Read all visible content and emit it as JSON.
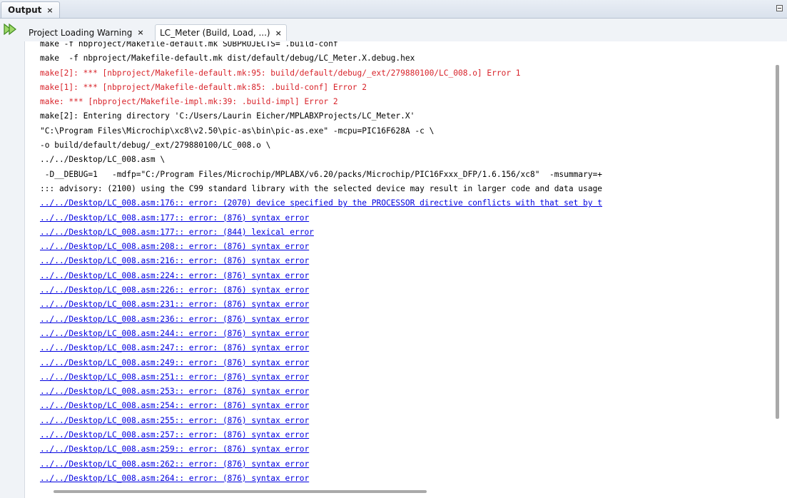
{
  "window": {
    "title": "Output",
    "close_glyph": "×"
  },
  "tabs": [
    {
      "label": "Project Loading Warning",
      "close_glyph": "×",
      "active": false
    },
    {
      "label": "LC_Meter (Build, Load, ...)",
      "close_glyph": "×",
      "active": true
    }
  ],
  "icons": {
    "rerun": "rerun-icon",
    "minimize": "minimize-icon"
  },
  "colors": {
    "normal_text": "#000000",
    "error_text": "#d8232a",
    "link_text": "#0000e0"
  },
  "output_lines": [
    {
      "type": "normal",
      "text": "make -f nbproject/Makefile-default.mk SUBPROJECTS= .build-conf"
    },
    {
      "type": "normal",
      "text": "make  -f nbproject/Makefile-default.mk dist/default/debug/LC_Meter.X.debug.hex"
    },
    {
      "type": "error",
      "text": "make[2]: *** [nbproject/Makefile-default.mk:95: build/default/debug/_ext/279880100/LC_008.o] Error 1"
    },
    {
      "type": "error",
      "text": "make[1]: *** [nbproject/Makefile-default.mk:85: .build-conf] Error 2"
    },
    {
      "type": "error",
      "text": "make: *** [nbproject/Makefile-impl.mk:39: .build-impl] Error 2"
    },
    {
      "type": "normal",
      "text": "make[2]: Entering directory 'C:/Users/Laurin Eicher/MPLABXProjects/LC_Meter.X'"
    },
    {
      "type": "normal",
      "text": "\"C:\\Program Files\\Microchip\\xc8\\v2.50\\pic-as\\bin\\pic-as.exe\" -mcpu=PIC16F628A -c \\"
    },
    {
      "type": "normal",
      "text": "-o build/default/debug/_ext/279880100/LC_008.o \\"
    },
    {
      "type": "normal",
      "text": "../../Desktop/LC_008.asm \\"
    },
    {
      "type": "normal",
      "text": " -D__DEBUG=1   -mdfp=\"C:/Program Files/Microchip/MPLABX/v6.20/packs/Microchip/PIC16Fxxx_DFP/1.6.156/xc8\"  -msummary=+"
    },
    {
      "type": "normal",
      "text": "::: advisory: (2100) using the C99 standard library with the selected device may result in larger code and data usage"
    },
    {
      "type": "link",
      "text": "../../Desktop/LC_008.asm:176:: error: (2070) device specified by the PROCESSOR directive conflicts with that set by t"
    },
    {
      "type": "link",
      "text": "../../Desktop/LC_008.asm:177:: error: (876) syntax error"
    },
    {
      "type": "link",
      "text": "../../Desktop/LC_008.asm:177:: error: (844) lexical error"
    },
    {
      "type": "link",
      "text": "../../Desktop/LC_008.asm:208:: error: (876) syntax error"
    },
    {
      "type": "link",
      "text": "../../Desktop/LC_008.asm:216:: error: (876) syntax error"
    },
    {
      "type": "link",
      "text": "../../Desktop/LC_008.asm:224:: error: (876) syntax error"
    },
    {
      "type": "link",
      "text": "../../Desktop/LC_008.asm:226:: error: (876) syntax error"
    },
    {
      "type": "link",
      "text": "../../Desktop/LC_008.asm:231:: error: (876) syntax error"
    },
    {
      "type": "link",
      "text": "../../Desktop/LC_008.asm:236:: error: (876) syntax error"
    },
    {
      "type": "link",
      "text": "../../Desktop/LC_008.asm:244:: error: (876) syntax error"
    },
    {
      "type": "link",
      "text": "../../Desktop/LC_008.asm:247:: error: (876) syntax error"
    },
    {
      "type": "link",
      "text": "../../Desktop/LC_008.asm:249:: error: (876) syntax error"
    },
    {
      "type": "link",
      "text": "../../Desktop/LC_008.asm:251:: error: (876) syntax error"
    },
    {
      "type": "link",
      "text": "../../Desktop/LC_008.asm:253:: error: (876) syntax error"
    },
    {
      "type": "link",
      "text": "../../Desktop/LC_008.asm:254:: error: (876) syntax error"
    },
    {
      "type": "link",
      "text": "../../Desktop/LC_008.asm:255:: error: (876) syntax error"
    },
    {
      "type": "link",
      "text": "../../Desktop/LC_008.asm:257:: error: (876) syntax error"
    },
    {
      "type": "link",
      "text": "../../Desktop/LC_008.asm:259:: error: (876) syntax error"
    },
    {
      "type": "link",
      "text": "../../Desktop/LC_008.asm:262:: error: (876) syntax error"
    },
    {
      "type": "link",
      "text": "../../Desktop/LC_008.asm:264:: error: (876) syntax error"
    }
  ]
}
